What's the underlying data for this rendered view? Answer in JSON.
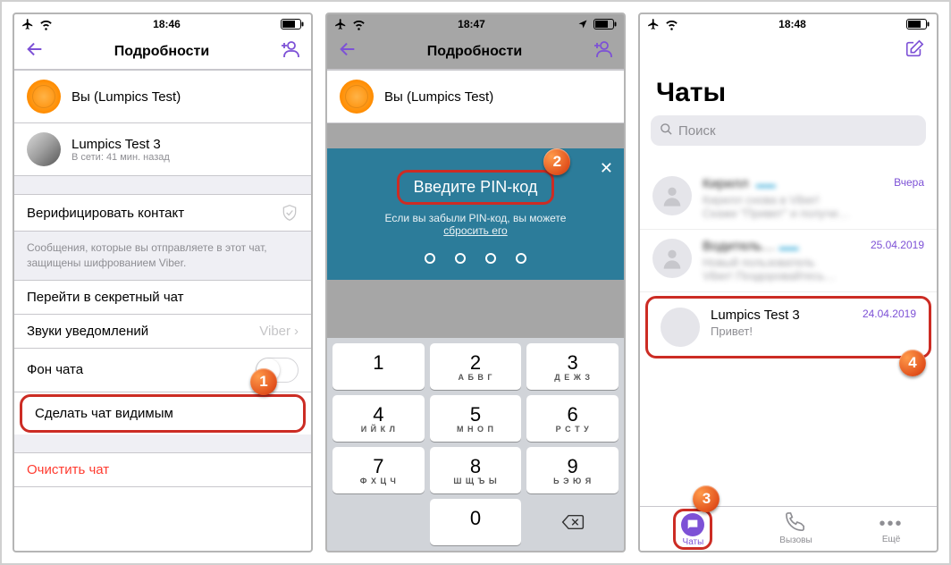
{
  "phone1": {
    "status_time": "18:46",
    "nav_title": "Подробности",
    "you_label": "Вы (Lumpics Test)",
    "contact_name": "Lumpics Test 3",
    "contact_status": "В сети: 41 мин. назад",
    "verify": "Верифицировать контакт",
    "encryption_note": "Сообщения, которые вы отправляете в этот чат, защищены шифрованием Viber.",
    "secret_chat": "Перейти в секретный чат",
    "sounds": "Звуки уведомлений",
    "sounds_value": "Viber",
    "background": "Фон чата",
    "make_visible": "Сделать чат видимым",
    "clear_chat": "Очистить чат",
    "badge": "1"
  },
  "phone2": {
    "status_time": "18:47",
    "nav_title": "Подробности",
    "you_label": "Вы (Lumpics Test)",
    "pin_title": "Введите PIN-код",
    "pin_sub_1": "Если вы забыли PIN-код, вы можете",
    "pin_sub_link": "сбросить его",
    "badge": "2",
    "keys": [
      {
        "d": "1",
        "l": ""
      },
      {
        "d": "2",
        "l": "А Б В Г"
      },
      {
        "d": "3",
        "l": "Д Е Ж З"
      },
      {
        "d": "4",
        "l": "И Й К Л"
      },
      {
        "d": "5",
        "l": "М Н О П"
      },
      {
        "d": "6",
        "l": "Р С Т У"
      },
      {
        "d": "7",
        "l": "Ф Х Ц Ч"
      },
      {
        "d": "8",
        "l": "Ш Щ Ъ Ы"
      },
      {
        "d": "9",
        "l": "Ь Э Ю Я"
      }
    ],
    "zero": "0"
  },
  "phone3": {
    "status_time": "18:48",
    "title": "Чаты",
    "search_placeholder": "Поиск",
    "chat1_date": "Вчера",
    "chat2_date": "25.04.2019",
    "chat3_name": "Lumpics Test 3",
    "chat3_msg": "Привет!",
    "chat3_date": "24.04.2019",
    "tab_chats": "Чаты",
    "tab_calls": "Вызовы",
    "tab_more": "Ещё",
    "badge3": "3",
    "badge4": "4"
  }
}
